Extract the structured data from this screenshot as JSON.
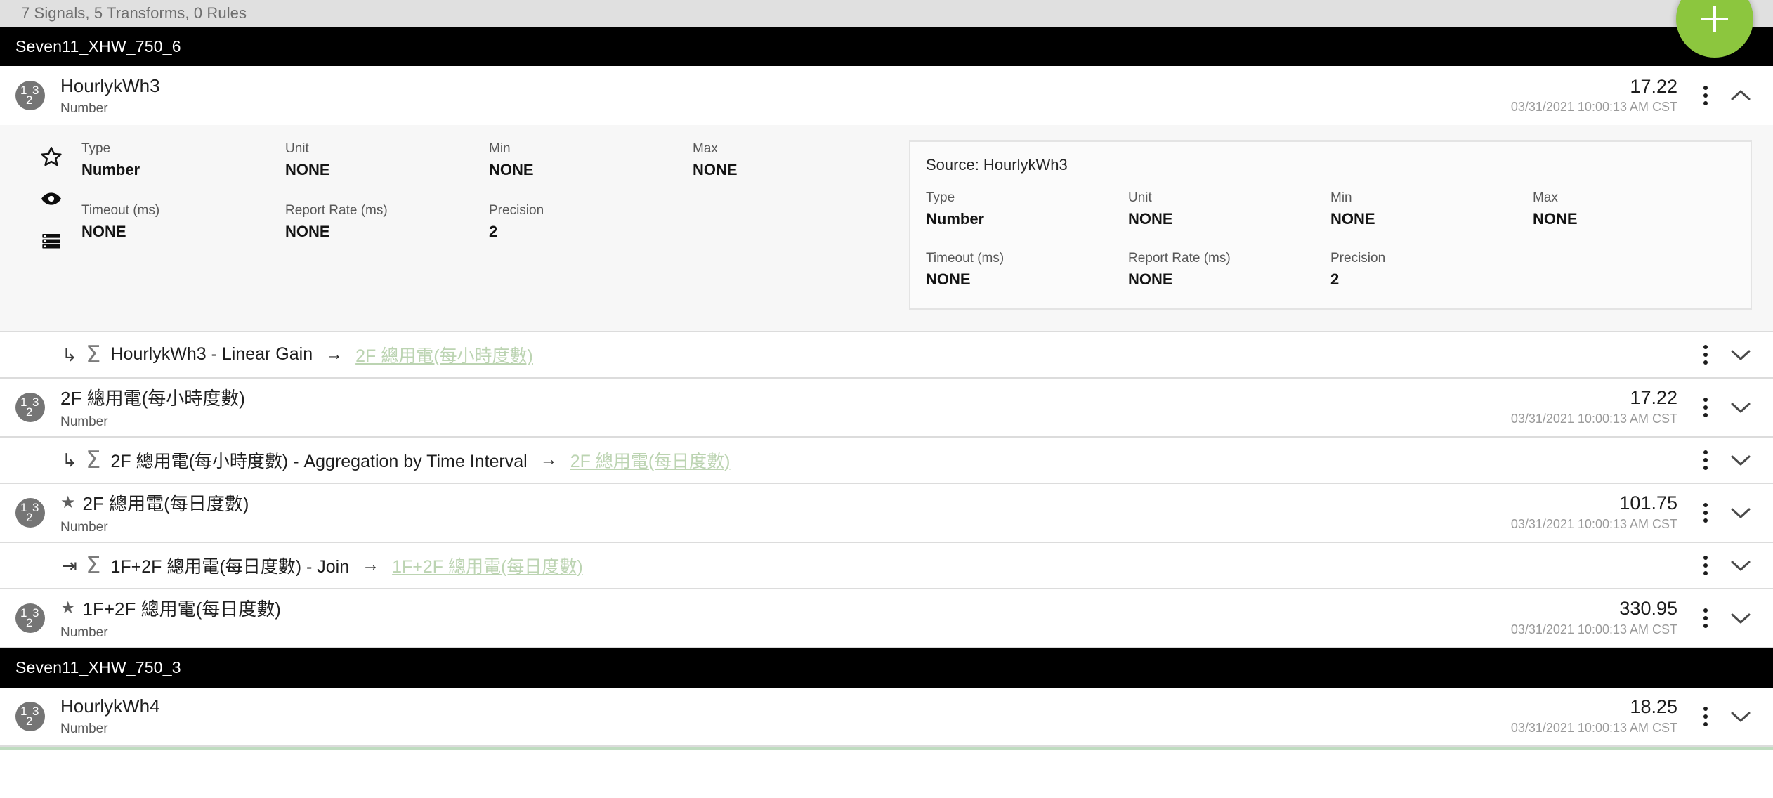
{
  "summary": {
    "text": "7 Signals, 5 Transforms, 0 Rules"
  },
  "fab": {
    "label": "+",
    "name": "add-button",
    "color": "#8cc63e"
  },
  "colors": {
    "group_header_bg": "#000000",
    "summary_bg": "#e0e0e0",
    "detail_bg": "#f7f7f7",
    "link_green": "#bcd4b2",
    "accent_green": "#8cc63e",
    "avatar_gray": "#757575"
  },
  "field_labels": {
    "type": "Type",
    "unit": "Unit",
    "min": "Min",
    "max": "Max",
    "timeout": "Timeout (ms)",
    "report_rate": "Report Rate (ms)",
    "precision": "Precision"
  },
  "icons": {
    "favorite": "star-outline-icon",
    "visibility": "eye-icon",
    "storage": "server-stack-icon",
    "kebab": "more-vertical-icon",
    "chevron_up": "chevron-up-icon",
    "chevron_down": "chevron-down-icon",
    "sigma": "sigma-icon",
    "branch": "branch-arrow-icon",
    "merge": "merge-arrow-icon",
    "arrow": "right-arrow-icon"
  },
  "groups": [
    {
      "title": "Seven11_XHW_750_6",
      "rows": [
        {
          "kind": "signal",
          "avatar": "123",
          "starred": false,
          "name": "HourlykWh3",
          "type": "Number",
          "value": "17.22",
          "timestamp": "03/31/2021 10:00:13 AM CST",
          "expanded": true,
          "chevron": "chevron-up-icon",
          "detail": {
            "fields": [
              {
                "label": "Type",
                "value": "Number"
              },
              {
                "label": "Unit",
                "value": "NONE"
              },
              {
                "label": "Min",
                "value": "NONE"
              },
              {
                "label": "Max",
                "value": "NONE"
              },
              {
                "label": "Timeout (ms)",
                "value": "NONE"
              },
              {
                "label": "Report Rate (ms)",
                "value": "NONE"
              },
              {
                "label": "Precision",
                "value": "2"
              }
            ],
            "source": {
              "title": "Source: HourlykWh3",
              "fields": [
                {
                  "label": "Type",
                  "value": "Number"
                },
                {
                  "label": "Unit",
                  "value": "NONE"
                },
                {
                  "label": "Min",
                  "value": "NONE"
                },
                {
                  "label": "Max",
                  "value": "NONE"
                },
                {
                  "label": "Timeout (ms)",
                  "value": "NONE"
                },
                {
                  "label": "Report Rate (ms)",
                  "value": "NONE"
                },
                {
                  "label": "Precision",
                  "value": "2"
                }
              ]
            }
          }
        },
        {
          "kind": "transform",
          "branch_icon": "branch-arrow-icon",
          "branch_glyph": "↳",
          "label": "HourlykWh3 - Linear Gain",
          "arrow": "→",
          "target": "2F 總用電(每小時度數)",
          "chevron": "chevron-down-icon"
        },
        {
          "kind": "signal",
          "avatar": "123",
          "starred": false,
          "name": "2F 總用電(每小時度數)",
          "type": "Number",
          "value": "17.22",
          "timestamp": "03/31/2021 10:00:13 AM CST",
          "expanded": false,
          "chevron": "chevron-down-icon"
        },
        {
          "kind": "transform",
          "branch_icon": "branch-arrow-icon",
          "branch_glyph": "↳",
          "label": "2F 總用電(每小時度數) - Aggregation by Time Interval",
          "arrow": "→",
          "target": "2F 總用電(每日度數)",
          "chevron": "chevron-down-icon"
        },
        {
          "kind": "signal",
          "avatar": "123",
          "starred": true,
          "star_glyph": "★",
          "name": "2F 總用電(每日度數)",
          "type": "Number",
          "value": "101.75",
          "timestamp": "03/31/2021 10:00:13 AM CST",
          "expanded": false,
          "chevron": "chevron-down-icon"
        },
        {
          "kind": "transform",
          "branch_icon": "merge-arrow-icon",
          "branch_glyph": "⇥",
          "label": "1F+2F 總用電(每日度數) - Join",
          "arrow": "→",
          "target": "1F+2F 總用電(每日度數)",
          "chevron": "chevron-down-icon"
        },
        {
          "kind": "signal",
          "avatar": "123",
          "starred": true,
          "star_glyph": "★",
          "name": "1F+2F 總用電(每日度數)",
          "type": "Number",
          "value": "330.95",
          "timestamp": "03/31/2021 10:00:13 AM CST",
          "expanded": false,
          "chevron": "chevron-down-icon"
        }
      ]
    },
    {
      "title": "Seven11_XHW_750_3",
      "rows": [
        {
          "kind": "signal",
          "avatar": "123",
          "starred": false,
          "name": "HourlykWh4",
          "type": "Number",
          "value": "18.25",
          "timestamp": "03/31/2021 10:00:13 AM CST",
          "expanded": false,
          "chevron": "chevron-down-icon",
          "clipped": true
        }
      ]
    }
  ]
}
